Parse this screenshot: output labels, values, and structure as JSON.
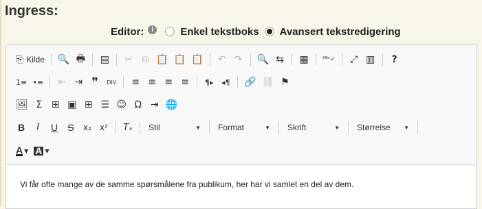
{
  "ingress_title": "Ingress:",
  "editor_label": "Editor:",
  "info_icon": "info-icon",
  "radio_options": [
    {
      "label": "Enkel tekstboks",
      "checked": false
    },
    {
      "label": "Avansert tekstredigering",
      "checked": true
    }
  ],
  "toolbar": {
    "source_label": "Kilde",
    "row1_icons": {
      "source": "⎘",
      "preview": "🔍",
      "print": "🖶",
      "templates": "▤",
      "cut": "✂",
      "copy": "⧉",
      "paste": "📋",
      "paste_text": "📋",
      "paste_word": "📋",
      "undo": "↶",
      "redo": "↷",
      "find": "🔍",
      "replace": "⇆",
      "select_all": "▦",
      "spellcheck": "ᴬᴮᶜ✓",
      "maximize": "⤢",
      "show_blocks": "▥",
      "about": "?"
    },
    "row2_icons": {
      "numbered_list": "1≡",
      "bulleted_list": "•≡",
      "outdent": "⇤",
      "indent": "⇥",
      "blockquote": "❞",
      "create_div": "DIV",
      "align_left": "≡",
      "align_center": "≡",
      "align_right": "≡",
      "justify": "≡",
      "ltr": "¶▸",
      "rtl": "◂¶",
      "link": "🔗",
      "unlink": "⛓",
      "anchor": "⚑"
    },
    "row3_icons": {
      "image": "🖼",
      "sigma": "Σ",
      "insert_chart": "⊞",
      "form": "▣",
      "table": "⊞",
      "horizontal_rule": "☰",
      "smiley": "☺",
      "special_char": "Ω",
      "page_break": "⇥",
      "iframe": "🌐"
    },
    "row4_icons": {
      "bold": "B",
      "italic": "I",
      "underline": "U",
      "strike": "S",
      "subscript": "x₂",
      "superscript": "x²",
      "remove_format": "Tₓ"
    },
    "combos": [
      {
        "label": "Stil"
      },
      {
        "label": "Format"
      },
      {
        "label": "Skrift"
      },
      {
        "label": "Størrelse"
      }
    ],
    "row5_icons": {
      "text_color": "A",
      "bg_color": "A"
    }
  },
  "content_text": "Vi får ofte mange av de samme spørsmålene fra publikum, her har vi samlet en del av dem."
}
